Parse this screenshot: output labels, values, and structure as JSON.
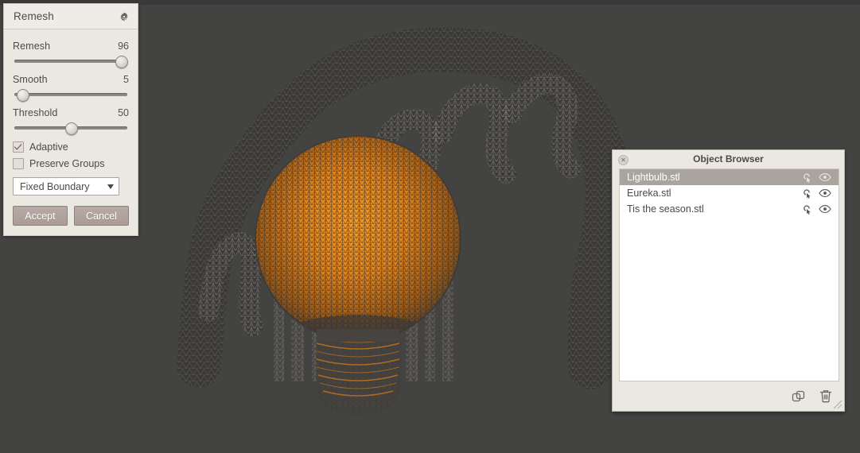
{
  "viewport": {
    "background_color": "#434341",
    "mesh_wire_color": "#c8c3bc",
    "mesh_highlight_color": "#e08a21",
    "mesh_dark_color": "#3a3a38",
    "scene_description": "3D triangulated lightbulb mesh with orange wireframe bulb and gray script text arch"
  },
  "tool_panel": {
    "title": "Remesh",
    "gear_icon": "gear-icon",
    "params": [
      {
        "name": "Remesh",
        "value": "96",
        "percent": 93
      },
      {
        "name": "Smooth",
        "value": "5",
        "percent": 8
      },
      {
        "name": "Threshold",
        "value": "50",
        "percent": 50
      }
    ],
    "checkboxes": [
      {
        "label": "Adaptive",
        "checked": true
      },
      {
        "label": "Preserve Groups",
        "checked": false
      }
    ],
    "boundary_select": {
      "value": "Fixed Boundary",
      "caret_icon": "chevron-down-icon"
    },
    "buttons": [
      {
        "label": "Accept"
      },
      {
        "label": "Cancel"
      }
    ],
    "colors": {
      "panel_bg": "#ebe7e1",
      "button_bg": "#b0a29c",
      "text": "#4d4945"
    }
  },
  "object_browser": {
    "title": "Object Browser",
    "close_icon": "close-icon",
    "close_glyph": "✕",
    "rows": [
      {
        "name": "Lightbulb.stl",
        "selected": true,
        "grab_icon": "grab-hand-icon",
        "visibility_icon": "eye-icon"
      },
      {
        "name": "Eureka.stl",
        "selected": false,
        "grab_icon": "grab-hand-icon",
        "visibility_icon": "eye-icon"
      },
      {
        "name": "Tis the season.stl",
        "selected": false,
        "grab_icon": "grab-hand-icon",
        "visibility_icon": "eye-icon"
      }
    ],
    "footer_actions": [
      {
        "name": "duplicate-button",
        "icon": "duplicate-icon"
      },
      {
        "name": "delete-button",
        "icon": "trash-icon"
      }
    ],
    "resize_grip_icon": "resize-grip-icon",
    "colors": {
      "selected_row_bg": "#a9a49d",
      "list_bg": "#ffffff"
    }
  }
}
